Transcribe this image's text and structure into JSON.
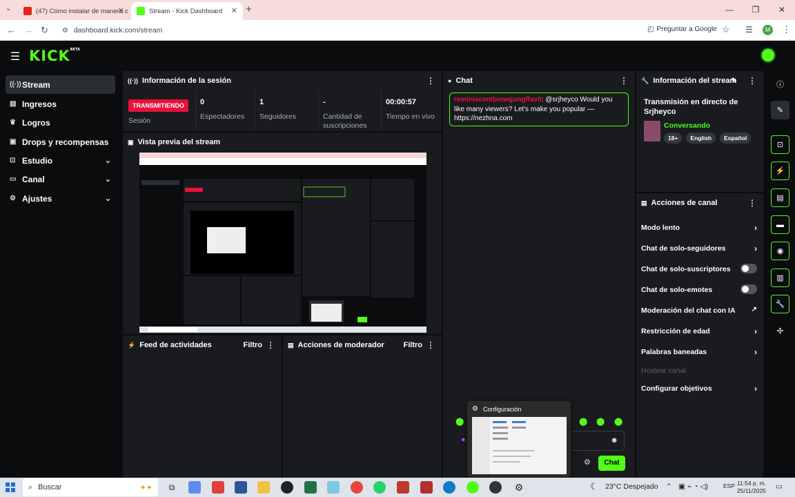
{
  "browser": {
    "tabs": [
      {
        "title": "(47) Cómo instalar de manera c"
      },
      {
        "title": "Stream - Kick Dashboard"
      }
    ],
    "url": "dashboard.kick.com/stream",
    "ask_google": "Preguntar a Google",
    "profile_initial": "M"
  },
  "brand": {
    "logo": "KICK",
    "badge": "BETA",
    "accent": "#53fc18"
  },
  "sidebar": {
    "items": [
      {
        "label": "Stream",
        "icon": "broadcast-icon"
      },
      {
        "label": "Ingresos",
        "icon": "chart-icon"
      },
      {
        "label": "Logros",
        "icon": "trophy-icon"
      },
      {
        "label": "Drops y recompensas",
        "icon": "gift-icon"
      },
      {
        "label": "Estudio",
        "icon": "studio-icon"
      },
      {
        "label": "Canal",
        "icon": "channel-icon"
      },
      {
        "label": "Ajustes",
        "icon": "gear-icon"
      }
    ]
  },
  "session": {
    "title": "Información de la sesión",
    "status": "TRANSMITIENDO",
    "status_label": "Sesión",
    "stats": [
      {
        "value": "0",
        "label": "Espectadores"
      },
      {
        "value": "1",
        "label": "Seguidores"
      },
      {
        "value": "-",
        "label": "Cantidad de suscripciones"
      },
      {
        "value": "00:00:57",
        "label": "Tiempo en vivo"
      }
    ]
  },
  "preview": {
    "title": "Vista previa del stream"
  },
  "activity": {
    "title": "Feed de actividades",
    "filter": "Filtro"
  },
  "moderator": {
    "title": "Acciones de moderador",
    "filter": "Filtro"
  },
  "chat": {
    "title": "Chat",
    "message_user": "reminiscentbiowgungffav0",
    "message_text": ": @srjheyco Would you like many viewers? Let's make you popular — https://nezhna.com",
    "send": "Chat"
  },
  "stream_info": {
    "title": "Información del stream",
    "stream_title": "Transmisión en directo de Srjheyco",
    "category": "Conversando",
    "tags": [
      "18+",
      "English",
      "Español"
    ]
  },
  "channel_actions": {
    "title": "Acciones de canal",
    "rows": [
      {
        "label": "Modo lento",
        "control": "chevron"
      },
      {
        "label": "Chat de solo-seguidores",
        "control": "chevron"
      },
      {
        "label": "Chat de solo-suscriptores",
        "control": "toggle"
      },
      {
        "label": "Chat de solo-emotes",
        "control": "toggle"
      },
      {
        "label": "Moderación del chat con IA",
        "control": "external"
      },
      {
        "label": "Restricción de edad",
        "control": "chevron"
      },
      {
        "label": "Palabras baneadas",
        "control": "chevron"
      },
      {
        "label": "Hostear canal",
        "control": "none"
      },
      {
        "label": "Configurar objetivos",
        "control": "chevron"
      }
    ]
  },
  "config_popup": {
    "title": "Configuración"
  },
  "taskbar": {
    "search": "Buscar",
    "weather": "23°C  Despejado",
    "lang": "ESP",
    "time": "11:54 p. m.",
    "date": "25/11/2025"
  }
}
